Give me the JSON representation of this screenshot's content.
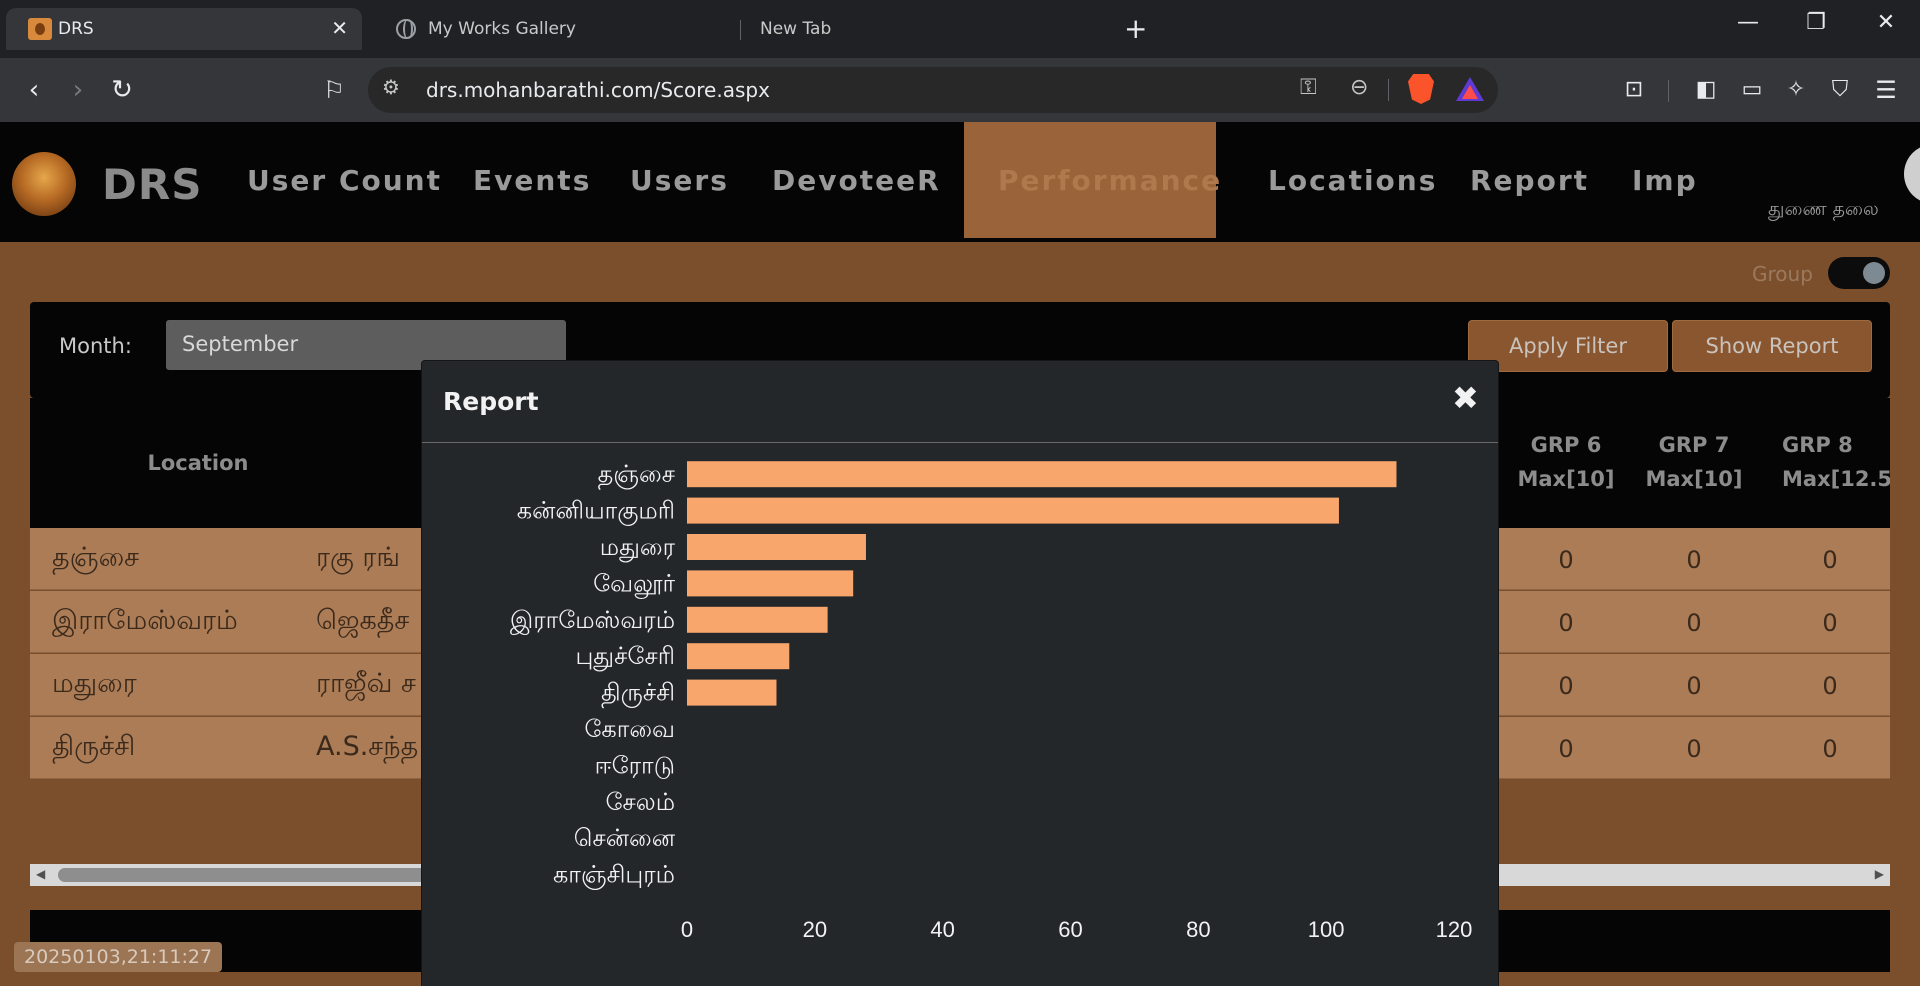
{
  "browser": {
    "tabs": [
      {
        "title": "DRS",
        "active": true
      },
      {
        "title": "My Works Gallery",
        "active": false
      },
      {
        "title": "New Tab",
        "active": false
      }
    ],
    "url": "drs.mohanbarathi.com/Score.aspx"
  },
  "nav": {
    "brand": "DRS",
    "items": [
      "User Count",
      "Events",
      "Users",
      "DevoteeR",
      "Performance",
      "Locations",
      "Report",
      "Imp"
    ],
    "active_item": "Performance",
    "tamil_tag": "துணை  தலை"
  },
  "filters": {
    "group_label": "Group",
    "month_label": "Month:",
    "month_value": "September",
    "apply_filter_label": "Apply Filter",
    "show_report_label": "Show Report"
  },
  "table": {
    "location_header": "Location",
    "grp_headers": [
      {
        "name": "GRP 6",
        "max": "Max[10]"
      },
      {
        "name": "GRP 7",
        "max": "Max[10]"
      },
      {
        "name": "GRP 8",
        "max": "Max[12.5"
      }
    ],
    "rows": [
      {
        "location": "தஞ்சை",
        "name": "ரகு ரங்",
        "grp6": "0",
        "grp7": "0",
        "grp8": "0"
      },
      {
        "location": "இராமேஸ்வரம்",
        "name": "ஜெகதீச",
        "grp6": "0",
        "grp7": "0",
        "grp8": "0"
      },
      {
        "location": "மதுரை",
        "name": "ராஜீவ் ச",
        "grp6": "0",
        "grp7": "0",
        "grp8": "0"
      },
      {
        "location": "திருச்சி",
        "name": "A.S.சந்த",
        "grp6": "0",
        "grp7": "0",
        "grp8": "0"
      }
    ]
  },
  "timestamp": "20250103,21:11:27",
  "modal": {
    "title": "Report",
    "close_glyph": "✖"
  },
  "colors": {
    "bar": "#f9a66c",
    "page_bg": "#7c4f2c",
    "modal_bg": "#23272a"
  },
  "chart_data": {
    "type": "bar",
    "orientation": "horizontal",
    "categories": [
      "தஞ்சை",
      "கன்னியாகுமரி",
      "மதுரை",
      "வேலூர்",
      "இராமேஸ்வரம்",
      "புதுச்சேரி",
      "திருச்சி",
      "கோவை",
      "ஈரோடு",
      "சேலம்",
      "சென்னை",
      "காஞ்சிபுரம்"
    ],
    "values": [
      111,
      102,
      28,
      26,
      22,
      16,
      14,
      0,
      0,
      0,
      0,
      0
    ],
    "xlim": [
      0,
      120
    ],
    "xticks": [
      0,
      20,
      40,
      60,
      80,
      100,
      120
    ],
    "grid": false,
    "legend": "none"
  }
}
